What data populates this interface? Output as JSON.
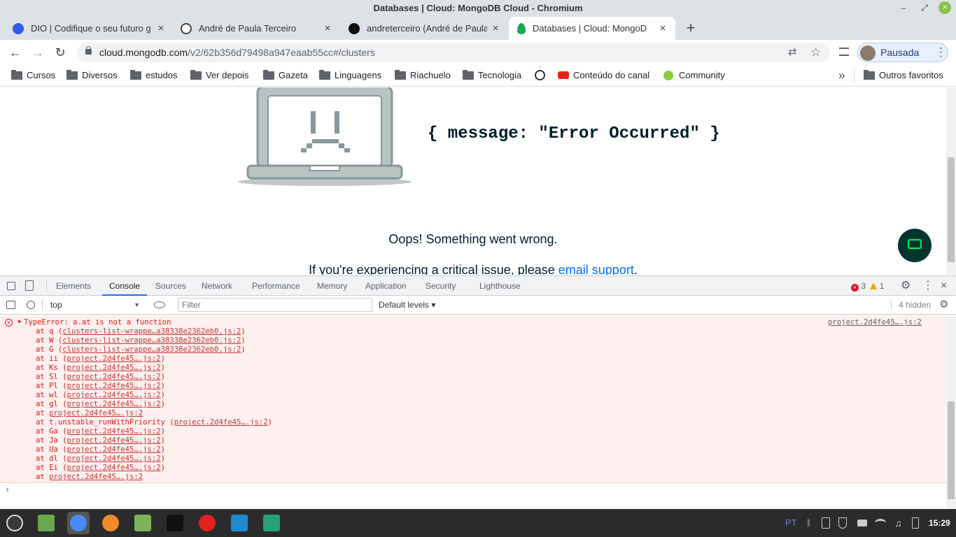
{
  "window": {
    "title": "Databases | Cloud: MongoDB Cloud - Chromium",
    "minimize_glyph": "–",
    "maximize_glyph": "⤢",
    "close_glyph": "×"
  },
  "tabs": [
    {
      "label": "DIO | Codifique o seu futuro g",
      "icon": "dio-icon",
      "color": "#2f5bea"
    },
    {
      "label": "André de Paula Terceiro",
      "icon": "globe-icon",
      "color": "#444444"
    },
    {
      "label": "andreterceiro (André de Paula",
      "icon": "github-icon",
      "color": "#111111"
    },
    {
      "label": "Databases | Cloud: MongoDB",
      "icon": "mongodb-leaf-icon",
      "color": "#13aa52",
      "active": true
    }
  ],
  "new_tab_glyph": "+",
  "tab_close_glyph": "×",
  "toolbar": {
    "back_glyph": "←",
    "forward_glyph": "→",
    "reload_glyph": "↻",
    "url_host": "cloud.mongodb.com",
    "url_path": "/v2/62b356d79498a947eaab55cc#/clusters",
    "translate_glyph": "⇄",
    "star_glyph": "☆",
    "profile_label": "Pausada",
    "menu_glyph": "⋮"
  },
  "bookmarks": [
    {
      "label": "Cursos",
      "type": "folder"
    },
    {
      "label": "Diversos",
      "type": "folder"
    },
    {
      "label": "estudos",
      "type": "folder"
    },
    {
      "label": "Ver depois",
      "type": "folder"
    },
    {
      "label": "Gazeta",
      "type": "folder"
    },
    {
      "label": "Linguagens",
      "type": "folder"
    },
    {
      "label": "Riachuelo",
      "type": "folder"
    },
    {
      "label": "Tecnologia",
      "type": "folder"
    },
    {
      "label": "",
      "type": "globe"
    },
    {
      "label": "Conteúdo do canal",
      "type": "youtube"
    },
    {
      "label": "Community",
      "type": "mint"
    }
  ],
  "bookmarks_overflow": "»",
  "other_bookmarks": "Outros favoritos",
  "page": {
    "error_message": "{ message: \"Error Occurred\" }",
    "oops": "Oops! Something went wrong.",
    "critical_prefix": "If you're experiencing a critical issue, please ",
    "critical_link": "email support",
    "critical_suffix": "."
  },
  "devtools": {
    "tabs": [
      "Elements",
      "Console",
      "Sources",
      "Network",
      "Performance",
      "Memory",
      "Application",
      "Security",
      "Lighthouse"
    ],
    "active_tab": "Console",
    "error_count": "3",
    "warning_count": "1",
    "context": "top",
    "filter_placeholder": "Filter",
    "levels": "Default levels ▾",
    "hidden": "4 hidden",
    "error_title": "TypeError: a.at is not a function",
    "error_source": "project.2d4fe45….js:2",
    "stack": [
      {
        "prefix": "at q (",
        "link": "clusters-list-wrappe…a38338e2362eb0.js:2",
        "suffix": ")"
      },
      {
        "prefix": "at W (",
        "link": "clusters-list-wrappe…a38338e2362eb0.js:2",
        "suffix": ")"
      },
      {
        "prefix": "at G (",
        "link": "clusters-list-wrappe…a38338e2362eb0.js:2",
        "suffix": ")"
      },
      {
        "prefix": "at ii (",
        "link": "project.2d4fe45….js:2",
        "suffix": ")"
      },
      {
        "prefix": "at Ks (",
        "link": "project.2d4fe45….js:2",
        "suffix": ")"
      },
      {
        "prefix": "at Sl (",
        "link": "project.2d4fe45….js:2",
        "suffix": ")"
      },
      {
        "prefix": "at Pl (",
        "link": "project.2d4fe45….js:2",
        "suffix": ")"
      },
      {
        "prefix": "at wl (",
        "link": "project.2d4fe45….js:2",
        "suffix": ")"
      },
      {
        "prefix": "at gl (",
        "link": "project.2d4fe45….js:2",
        "suffix": ")"
      },
      {
        "prefix": "at ",
        "link": "project.2d4fe45….js:2",
        "suffix": ""
      },
      {
        "prefix": "at t.unstable_runWithPriority (",
        "link": "project.2d4fe45….js:2",
        "suffix": ")"
      },
      {
        "prefix": "at Ga (",
        "link": "project.2d4fe45….js:2",
        "suffix": ")"
      },
      {
        "prefix": "at Ja (",
        "link": "project.2d4fe45….js:2",
        "suffix": ")"
      },
      {
        "prefix": "at Ua (",
        "link": "project.2d4fe45….js:2",
        "suffix": ")"
      },
      {
        "prefix": "at dl (",
        "link": "project.2d4fe45….js:2",
        "suffix": ")"
      },
      {
        "prefix": "at Ei (",
        "link": "project.2d4fe45….js:2",
        "suffix": ")"
      },
      {
        "prefix": "at ",
        "link": "project.2d4fe45….js:2",
        "suffix": ""
      }
    ],
    "prompt_glyph": "›"
  },
  "taskbar": {
    "apps": [
      {
        "name": "mint-menu-icon",
        "color": "#3a3a3a"
      },
      {
        "name": "files-icon",
        "color": "#6aa84f"
      },
      {
        "name": "chromium-icon",
        "color": "#4a8af4",
        "active": true
      },
      {
        "name": "firefox-icon",
        "color": "#f08a24"
      },
      {
        "name": "folder-icon",
        "color": "#7cb35a"
      },
      {
        "name": "terminal-icon",
        "color": "#111111"
      },
      {
        "name": "opera-icon",
        "color": "#e0201e"
      },
      {
        "name": "vscode-icon",
        "color": "#1f8ad2"
      },
      {
        "name": "dbeaver-icon",
        "color": "#2aa07a"
      }
    ],
    "keyboard_layout": "PT",
    "time": "15:29"
  }
}
